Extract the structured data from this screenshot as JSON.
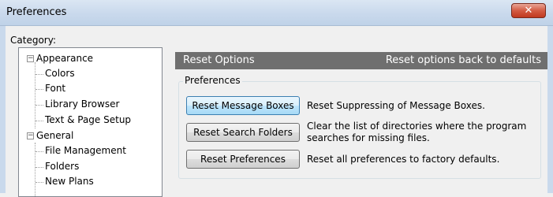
{
  "window": {
    "title": "Preferences",
    "close_icon": "close-icon"
  },
  "category_label": "Category:",
  "tree": [
    {
      "label": "Appearance",
      "level": 0,
      "expander": "−"
    },
    {
      "label": "Colors",
      "level": 1
    },
    {
      "label": "Font",
      "level": 1
    },
    {
      "label": "Library Browser",
      "level": 1
    },
    {
      "label": "Text & Page Setup",
      "level": 1
    },
    {
      "label": "General",
      "level": 0,
      "expander": "−"
    },
    {
      "label": "File Management",
      "level": 1
    },
    {
      "label": "Folders",
      "level": 1
    },
    {
      "label": "New Plans",
      "level": 1
    }
  ],
  "panel": {
    "title": "Reset Options",
    "subtitle": "Reset options back to defaults",
    "group_label": "Preferences"
  },
  "actions": [
    {
      "button": "Reset Message Boxes",
      "description": "Reset Suppressing of Message Boxes."
    },
    {
      "button": "Reset Search Folders",
      "description": "Clear the list of directories where the program searches for missing files."
    },
    {
      "button": "Reset Preferences",
      "description": "Reset all preferences to factory defaults."
    }
  ]
}
